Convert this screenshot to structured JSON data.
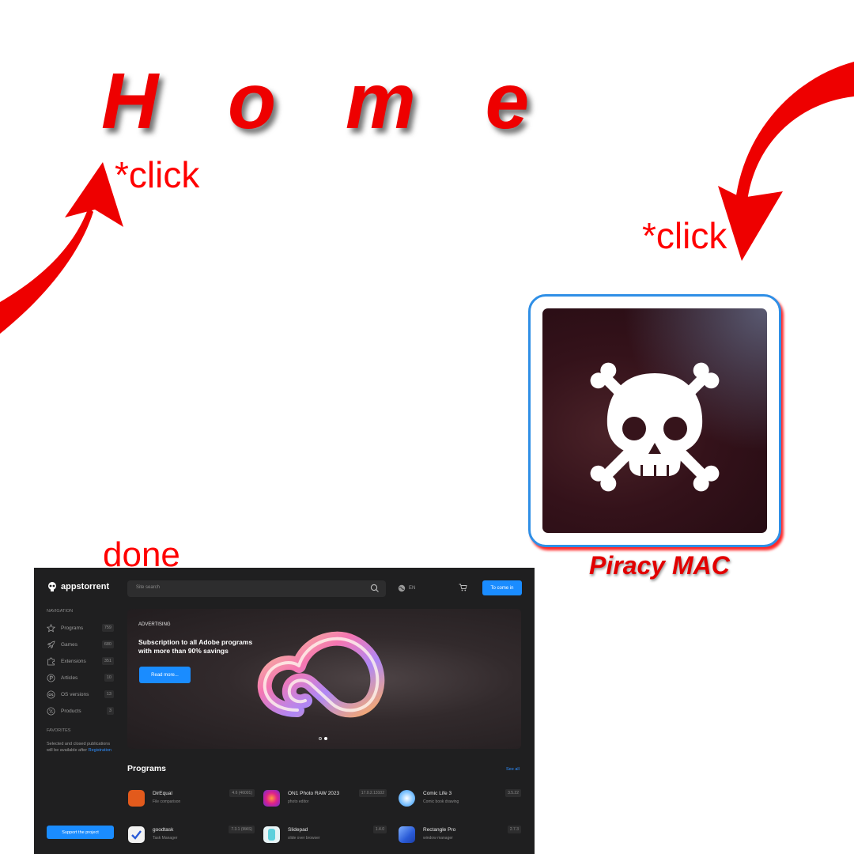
{
  "annotations": {
    "home_title": "H o m e",
    "click_1": "*click",
    "click_2": "*click",
    "done": "done",
    "icon_caption": "Piracy MAC",
    "arrow_color": "#ff0000"
  },
  "app_icon": {
    "icon": "skull-crossbones-icon",
    "frame_color": "#2f8fe6"
  },
  "screenshot": {
    "brand": "appstorrent",
    "search_placeholder": "Site search",
    "language": "EN",
    "login_button": "To come in",
    "accent": "#1a8cff",
    "sidebar": {
      "navigation_header": "NAVIGATION",
      "items": [
        {
          "label": "Programs",
          "count": "759",
          "icon": "star-icon"
        },
        {
          "label": "Games",
          "count": "680",
          "icon": "rocket-icon"
        },
        {
          "label": "Extensions",
          "count": "351",
          "icon": "puzzle-icon"
        },
        {
          "label": "Articles",
          "count": "10",
          "icon": "p-circle-icon"
        },
        {
          "label": "OS versions",
          "count": "13",
          "icon": "os-circle-icon"
        },
        {
          "label": "Products",
          "count": "3",
          "icon": "percent-circle-icon"
        }
      ],
      "favorites_header": "FAVORITES",
      "favorites_note": "Selected and closed publications will be available after",
      "registration_link": "Registration",
      "support_button": "Support the project"
    },
    "banner": {
      "tag": "ADVERTISING",
      "headline": "Subscription to all Adobe programs with more than 90% savings",
      "button": "Read more...",
      "slides": 2,
      "active_slide": 2
    },
    "programs": {
      "heading": "Programs",
      "see_all": "See all",
      "items": [
        {
          "name": "DirEqual",
          "desc": "File comparison",
          "version": "4.6 (46001)",
          "icon_color": "#e25a1c"
        },
        {
          "name": "ON1 Photo RAW 2023",
          "desc": "photo editor",
          "version": "17.0.2.13102",
          "icon_color": "#7b2cbf"
        },
        {
          "name": "Comic Life 3",
          "desc": "Comic book drawing",
          "version": "3.5.22",
          "icon_color": "#3a8ee6"
        },
        {
          "name": "goodtask",
          "desc": "Task Manager",
          "version": "7.3.1 (MAS)",
          "icon_color": "#f2f2f2"
        },
        {
          "name": "Slidepad",
          "desc": "slide over browser",
          "version": "1.4.0",
          "icon_color": "#e8f4f6"
        },
        {
          "name": "Rectangle Pro",
          "desc": "window manager",
          "version": "2.7.3",
          "icon_color": "#2a5bd7"
        }
      ]
    }
  }
}
